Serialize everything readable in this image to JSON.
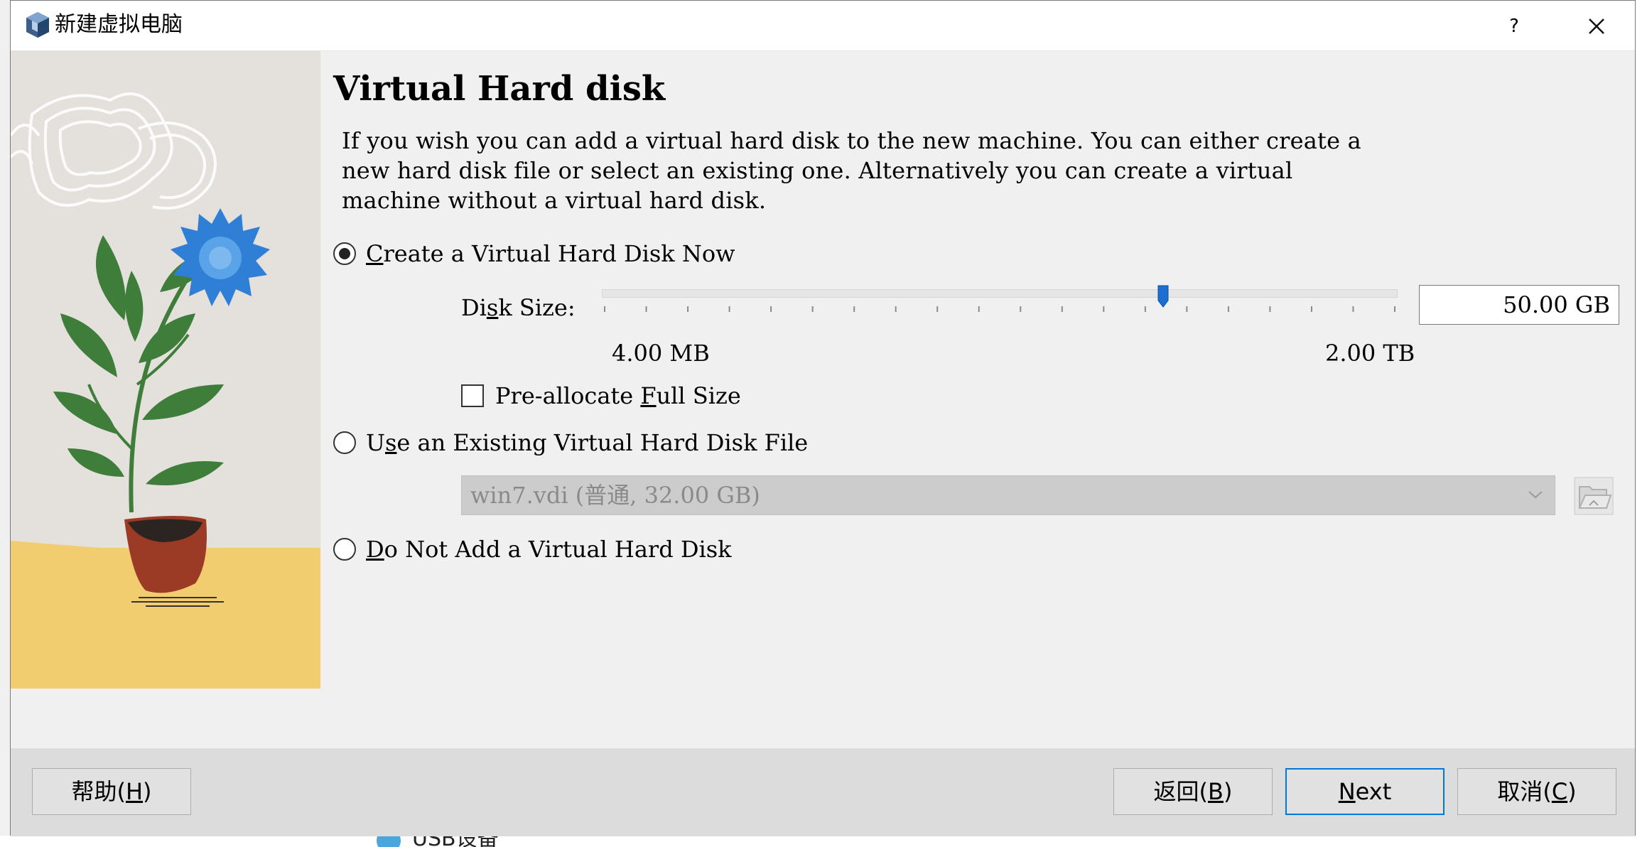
{
  "window": {
    "title": "新建虚拟电脑",
    "help_label": "?",
    "app_icon": "virtualbox-cube-icon",
    "close_icon": "close-icon"
  },
  "page": {
    "heading": "Virtual Hard disk",
    "description_lines": [
      "If you wish you can add a virtual hard disk to the new machine. You can either create a",
      "new hard disk file or select an existing one. Alternatively you can create a virtual",
      "machine without a virtual hard disk."
    ]
  },
  "options": {
    "create_now": {
      "prefix": "",
      "mnemonic": "C",
      "suffix": "reate a Virtual Hard Disk Now",
      "checked": true
    },
    "use_existing": {
      "prefix": "U",
      "mnemonic": "s",
      "suffix": "e an Existing Virtual Hard Disk File",
      "checked": false
    },
    "no_disk": {
      "prefix": "",
      "mnemonic": "D",
      "suffix": "o Not Add a Virtual Hard Disk",
      "checked": false
    }
  },
  "disk_size": {
    "label_prefix": "Di",
    "label_mnemonic": "s",
    "label_suffix": "k Size:",
    "value": "50.00 GB",
    "min_label": "4.00 MB",
    "max_label": "2.00 TB",
    "slider_position_fraction": 0.705,
    "tick_count": 20
  },
  "preallocate": {
    "prefix": "Pre-allocate ",
    "mnemonic": "F",
    "suffix": "ull Size",
    "checked": false
  },
  "existing_disk": {
    "selected": "win7.vdi (普通, 32.00 GB)",
    "folder_icon": "folder-open-icon"
  },
  "footer": {
    "help": {
      "text": "帮助(",
      "mnemonic": "H",
      "close": ")"
    },
    "back": {
      "text": "返回(",
      "mnemonic": "B",
      "close": ")"
    },
    "next": {
      "text": "",
      "mnemonic": "N",
      "close": "ext"
    },
    "cancel": {
      "text": "取消(",
      "mnemonic": "C",
      "close": ")"
    }
  },
  "background": {
    "partial_text": "USB设备"
  },
  "colors": {
    "accent": "#0078d7",
    "slider_handle": "#1b6fd1",
    "dialog_bg": "#f0f0f0",
    "footer_bg": "#dcdcdc",
    "disabled_field": "#cccccc"
  }
}
